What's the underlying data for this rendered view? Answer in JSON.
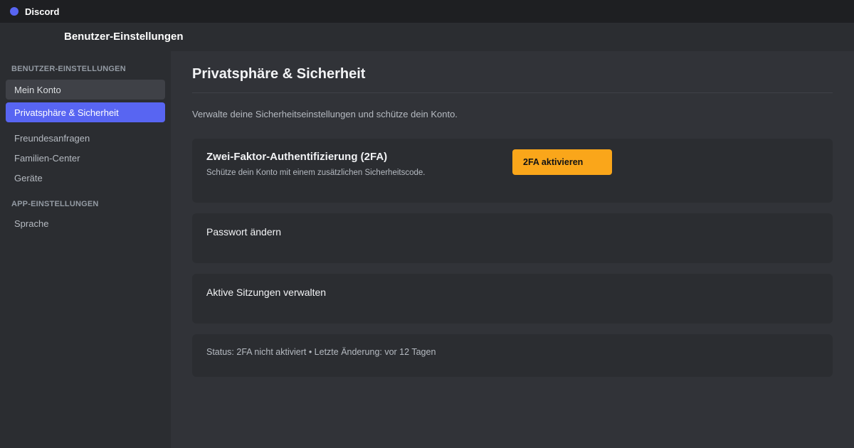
{
  "app": {
    "name": "Discord",
    "accent": "#5865f2"
  },
  "header": {
    "title": "Benutzer-Einstellungen"
  },
  "sidebar": {
    "section_user": "BENUTZER-EINSTELLUNGEN",
    "section_app": "APP-EINSTELLUNGEN",
    "items": [
      {
        "label": "Mein Konto"
      },
      {
        "label": "Privatsphäre & Sicherheit",
        "selected": true
      },
      {
        "label": "Freundesanfragen"
      },
      {
        "label": "Familien-Center"
      },
      {
        "label": "Geräte"
      },
      {
        "label": "Sprache"
      }
    ]
  },
  "main": {
    "title": "Privatsphäre & Sicherheit",
    "description": "Verwalte deine Sicherheitseinstellungen und schütze dein Konto.",
    "twofa": {
      "title": "Zwei-Faktor-Authentifizierung (2FA)",
      "subtitle": "Schütze dein Konto mit einem zusätzlichen Sicherheitscode.",
      "button_label": "2FA aktivieren",
      "button_color": "#faa61a"
    },
    "password": {
      "label": "Passwort ändern"
    },
    "sessions": {
      "label": "Aktive Sitzungen verwalten"
    },
    "status": {
      "text": "Status: 2FA nicht aktiviert • Letzte Änderung: vor 12 Tagen"
    }
  }
}
